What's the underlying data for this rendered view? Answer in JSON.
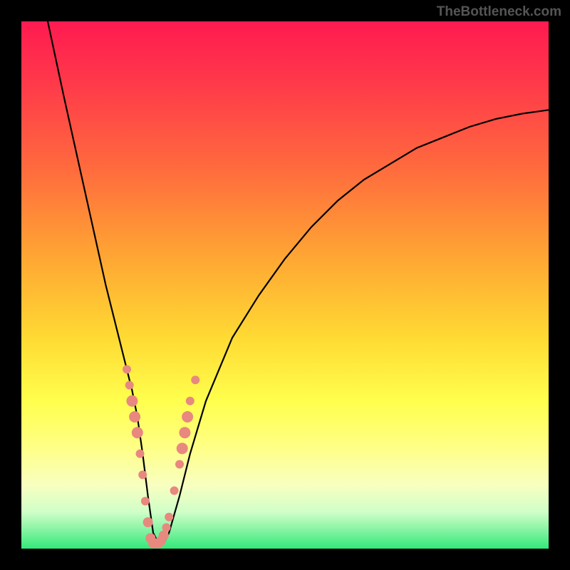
{
  "watermark": "TheBottleneck.com",
  "chart_data": {
    "type": "line",
    "title": "",
    "xlabel": "",
    "ylabel": "",
    "xlim": [
      0,
      100
    ],
    "ylim": [
      0,
      100
    ],
    "gradient_colors": {
      "top": "#ff2a55",
      "mid_upper": "#ff6b3d",
      "mid": "#ffda33",
      "mid_lower": "#ffff66",
      "lower": "#f5ffb0",
      "bottom": "#33e97a"
    },
    "series": [
      {
        "name": "bottleneck-curve",
        "color": "#000000",
        "x": [
          5,
          8,
          10,
          12,
          14,
          16,
          18,
          20,
          21,
          22,
          23,
          24,
          25,
          26,
          27,
          28,
          30,
          32,
          35,
          40,
          45,
          50,
          55,
          60,
          65,
          70,
          75,
          80,
          85,
          90,
          95,
          100
        ],
        "y": [
          100,
          86,
          77,
          68,
          59,
          50,
          42,
          34,
          30,
          25,
          18,
          10,
          3,
          1,
          1,
          3,
          10,
          18,
          28,
          40,
          48,
          55,
          61,
          66,
          70,
          73,
          76,
          78,
          80,
          81.5,
          82.5,
          83.2
        ]
      }
    ],
    "markers": {
      "name": "highlighted-points",
      "color": "#e8887f",
      "points": [
        {
          "x": 20,
          "y": 34,
          "size": 6
        },
        {
          "x": 20.5,
          "y": 31,
          "size": 6
        },
        {
          "x": 21,
          "y": 28,
          "size": 8
        },
        {
          "x": 21.5,
          "y": 25,
          "size": 8
        },
        {
          "x": 22,
          "y": 22,
          "size": 8
        },
        {
          "x": 22.5,
          "y": 18,
          "size": 6
        },
        {
          "x": 23,
          "y": 14,
          "size": 6
        },
        {
          "x": 23.5,
          "y": 9,
          "size": 6
        },
        {
          "x": 24,
          "y": 5,
          "size": 7
        },
        {
          "x": 24.5,
          "y": 2,
          "size": 7
        },
        {
          "x": 25,
          "y": 1,
          "size": 7
        },
        {
          "x": 25.5,
          "y": 1,
          "size": 7
        },
        {
          "x": 26,
          "y": 1,
          "size": 7
        },
        {
          "x": 26.5,
          "y": 1.5,
          "size": 7
        },
        {
          "x": 27,
          "y": 2.5,
          "size": 7
        },
        {
          "x": 27.5,
          "y": 4,
          "size": 6
        },
        {
          "x": 28,
          "y": 6,
          "size": 6
        },
        {
          "x": 29,
          "y": 11,
          "size": 6
        },
        {
          "x": 30,
          "y": 16,
          "size": 6
        },
        {
          "x": 30.5,
          "y": 19,
          "size": 8
        },
        {
          "x": 31,
          "y": 22,
          "size": 8
        },
        {
          "x": 31.5,
          "y": 25,
          "size": 8
        },
        {
          "x": 32,
          "y": 28,
          "size": 6
        },
        {
          "x": 33,
          "y": 32,
          "size": 6
        }
      ]
    }
  }
}
